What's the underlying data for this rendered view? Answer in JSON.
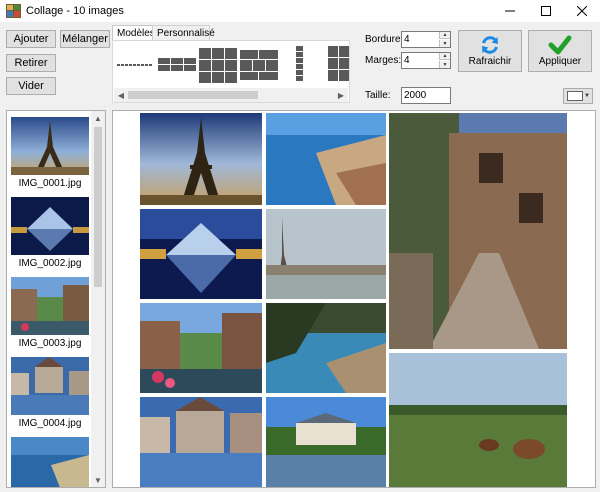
{
  "window": {
    "title": "Collage - 10 images",
    "icon": "collage-app-icon"
  },
  "left_buttons": {
    "add": "Ajouter",
    "shuffle": "Mélanger",
    "remove": "Retirer",
    "clear": "Vider"
  },
  "tabs": [
    {
      "label": "Modèles",
      "active": true
    },
    {
      "label": "Personnalisé",
      "active": false
    }
  ],
  "fields": {
    "border_label": "Bordure:",
    "border_value": "4",
    "margins_label": "Marges:",
    "margins_value": "4",
    "size_label": "Taille:",
    "size_value": "2000"
  },
  "actions": {
    "refresh": "Rafraichir",
    "apply": "Appliquer"
  },
  "background_color": "#ffffff",
  "accent_colors": {
    "refresh_icon": "#1e88e5",
    "apply_icon": "#22a02a"
  },
  "thumbnails": [
    {
      "filename": "IMG_0001.jpg"
    },
    {
      "filename": "IMG_0002.jpg"
    },
    {
      "filename": "IMG_0003.jpg"
    },
    {
      "filename": "IMG_0004.jpg"
    },
    {
      "filename": ""
    }
  ]
}
